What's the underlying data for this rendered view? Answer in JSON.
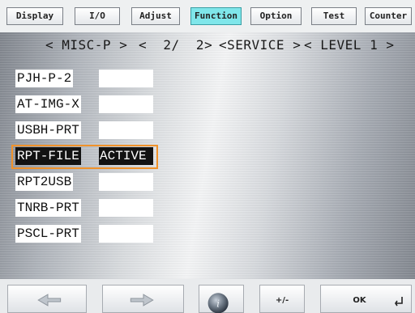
{
  "tabs": [
    {
      "label": "Display",
      "active": false
    },
    {
      "label": "I/O",
      "active": false
    },
    {
      "label": "Adjust",
      "active": false
    },
    {
      "label": "Function",
      "active": true
    },
    {
      "label": "Option",
      "active": false
    },
    {
      "label": "Test",
      "active": false
    },
    {
      "label": "Counter",
      "active": false
    }
  ],
  "nav": {
    "menu": "< MISC-P >",
    "page": "<  2/  2>",
    "mode": "<SERVICE >",
    "level": "< LEVEL 1 >"
  },
  "items": [
    {
      "label": "PJH-P-2",
      "value": ""
    },
    {
      "label": "AT-IMG-X",
      "value": ""
    },
    {
      "label": "USBH-PRT",
      "value": ""
    },
    {
      "label": "RPT-FILE",
      "value": "ACTIVE",
      "selected": true
    },
    {
      "label": "RPT2USB",
      "value": ""
    },
    {
      "label": "TNRB-PRT",
      "value": ""
    },
    {
      "label": "PSCL-PRT",
      "value": ""
    }
  ],
  "buttons": {
    "left_icon": "left-arrow-icon",
    "right_icon": "right-arrow-icon",
    "info_icon": "info-icon",
    "plusminus_label": "+/-",
    "ok_label": "OK",
    "enter_icon": "enter-icon"
  },
  "colors": {
    "active_tab": "#7fe6ea",
    "selection_frame": "#f0922a",
    "selected_row_bg": "#121212"
  }
}
